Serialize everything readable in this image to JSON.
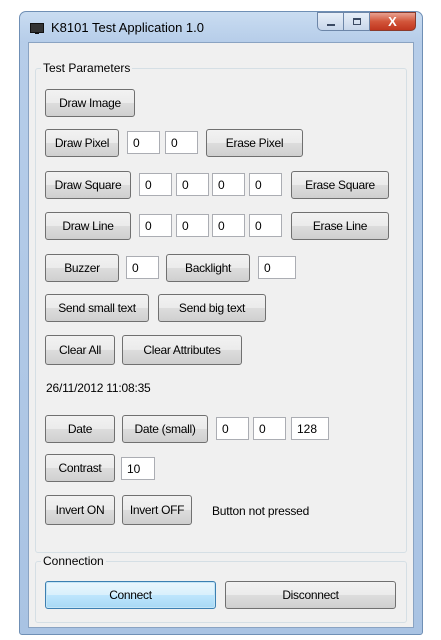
{
  "window": {
    "title": "K8101 Test Application 1.0",
    "close_glyph": "X"
  },
  "test_group": {
    "label": "Test Parameters"
  },
  "buttons": {
    "draw_image": "Draw Image",
    "draw_pixel": "Draw Pixel",
    "erase_pixel": "Erase Pixel",
    "draw_square": "Draw Square",
    "erase_square": "Erase Square",
    "draw_line": "Draw Line",
    "erase_line": "Erase Line",
    "buzzer": "Buzzer",
    "backlight": "Backlight",
    "send_small_text": "Send small text",
    "send_big_text": "Send big text",
    "clear_all": "Clear All",
    "clear_attributes": "Clear Attributes",
    "date": "Date",
    "date_small": "Date (small)",
    "contrast": "Contrast",
    "invert_on": "Invert ON",
    "invert_off": "Invert OFF"
  },
  "fields": {
    "pixel_x": "0",
    "pixel_y": "0",
    "square_x1": "0",
    "square_y1": "0",
    "square_x2": "0",
    "square_y2": "0",
    "line_x1": "0",
    "line_y1": "0",
    "line_x2": "0",
    "line_y2": "0",
    "buzzer": "0",
    "backlight": "0",
    "date_x": "0",
    "date_y": "0",
    "date_color": "128",
    "contrast": "10"
  },
  "datetime": "26/11/2012 11:08:35",
  "status": "Button not pressed",
  "connection_group": {
    "label": "Connection",
    "connect": "Connect",
    "disconnect": "Disconnect"
  }
}
